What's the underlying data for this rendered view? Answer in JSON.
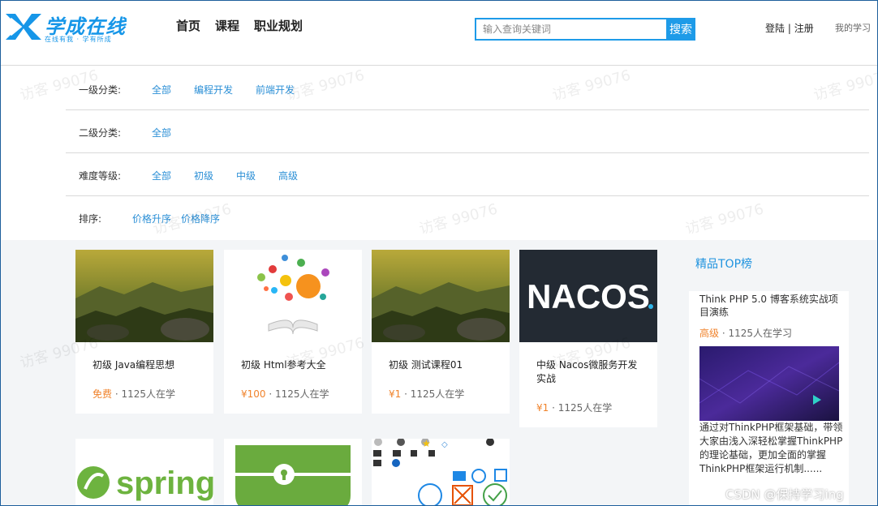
{
  "header": {
    "logo_title": "学成在线",
    "logo_slogan": "在线有我 · 学有所成",
    "nav": [
      "首页",
      "课程",
      "职业规划"
    ],
    "search_placeholder": "输入查询关键词",
    "search_button": "搜索",
    "login": "登陆",
    "separator": " | ",
    "register": "注册",
    "my_study": "我的学习",
    "brand_color": "#1696e8"
  },
  "filters": [
    {
      "label": "一级分类:",
      "options": [
        "全部",
        "编程开发",
        "前端开发"
      ]
    },
    {
      "label": "二级分类:",
      "options": [
        "全部"
      ]
    },
    {
      "label": "难度等级:",
      "options": [
        "全部",
        "初级",
        "中级",
        "高级"
      ]
    },
    {
      "label": "排序:",
      "options": [
        "价格升序",
        "价格降序"
      ]
    }
  ],
  "courses": [
    {
      "title": "初级 Java编程思想",
      "price": "免费",
      "learners": "1125人在学",
      "image": "mountain-landscape-image"
    },
    {
      "title": "初级 Html参考大全",
      "price": "¥100",
      "learners": "1125人在学",
      "image": "open-book-bubbles-image"
    },
    {
      "title": "初级 测试课程01",
      "price": "¥1",
      "learners": "1125人在学",
      "image": "mountain-landscape-image"
    },
    {
      "title": "中级 Nacos微服务开发实战",
      "price": "¥1",
      "learners": "1125人在学",
      "image": "nacos-logo-image"
    }
  ],
  "courses_row2": [
    {
      "image": "spring-logo-image",
      "text": "spring"
    },
    {
      "image": "green-shield-key-image"
    },
    {
      "image": "icon-collection-image"
    }
  ],
  "top_list": {
    "title": "精品TOP榜",
    "item": {
      "name": "Think PHP 5.0 博客系统实战项目演练",
      "level": "高级",
      "learners": "1125人在学习",
      "description": "通过对ThinkPHP框架基础，带领大家由浅入深轻松掌握ThinkPHP的理论基础，更加全面的掌握ThinkPHP框架运行机制......"
    }
  },
  "watermark": "访客 99076",
  "csdn_mark": "CSDN @保持学习ing",
  "colors": {
    "accent": "#1e9be8",
    "price": "#f0832c",
    "link": "#2b8fd6",
    "background": "#f3f5f7"
  }
}
